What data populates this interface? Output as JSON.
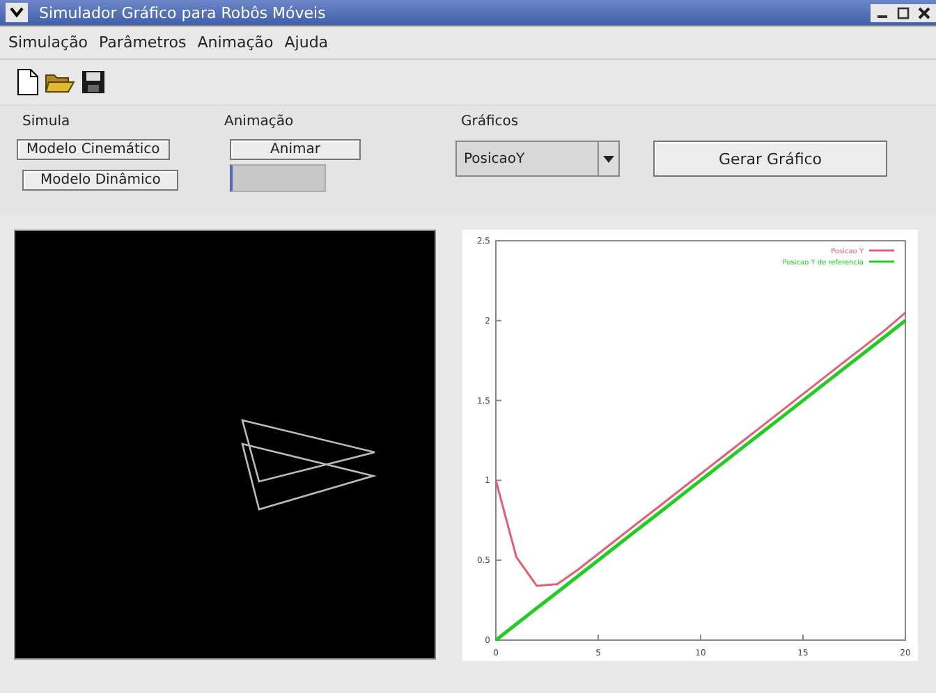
{
  "window": {
    "title": "Simulador Gráfico para Robôs Móveis"
  },
  "menu": [
    {
      "label": "Simulação"
    },
    {
      "label": "Parâmetros"
    },
    {
      "label": "Animação"
    },
    {
      "label": "Ajuda"
    }
  ],
  "toolbar": [
    {
      "kind": "new"
    },
    {
      "kind": "open"
    },
    {
      "kind": "save"
    }
  ],
  "simula": {
    "title": "Simula",
    "buttons": [
      "Modelo Cinemático",
      "Modelo Dinâmico"
    ]
  },
  "animacao": {
    "title": "Animação",
    "button": "Animar"
  },
  "graficos": {
    "title": "Gráficos",
    "select": {
      "value": "PosicaoY"
    },
    "button": "Gerar Gráfico"
  },
  "chart": {
    "chart_data": {
      "type": "line",
      "legend": true,
      "x": [
        0,
        1,
        2,
        3,
        4,
        5,
        6,
        7,
        8,
        9,
        10,
        11,
        12,
        13,
        14,
        15,
        16,
        17,
        18,
        19,
        20
      ],
      "xlim": [
        0,
        20
      ],
      "ylim": [
        0,
        2.5
      ],
      "xticks": [
        0,
        5,
        10,
        15,
        20
      ],
      "yticks": [
        0,
        0.5,
        1,
        1.5,
        2,
        2.5
      ],
      "series": [
        {
          "name": "Posicao Y",
          "color": "#e06070",
          "values": [
            1.0,
            0.52,
            0.34,
            0.35,
            0.44,
            0.54,
            0.64,
            0.74,
            0.84,
            0.94,
            1.04,
            1.14,
            1.24,
            1.34,
            1.44,
            1.54,
            1.64,
            1.74,
            1.84,
            1.94,
            2.05
          ]
        },
        {
          "name": "Posicao Y de referencia",
          "color": "#22cc22",
          "values": [
            0,
            0.1,
            0.2,
            0.3,
            0.4,
            0.5,
            0.6,
            0.7,
            0.8,
            0.9,
            1.0,
            1.1,
            1.2,
            1.3,
            1.4,
            1.5,
            1.6,
            1.7,
            1.8,
            1.9,
            2.0
          ]
        }
      ]
    }
  }
}
